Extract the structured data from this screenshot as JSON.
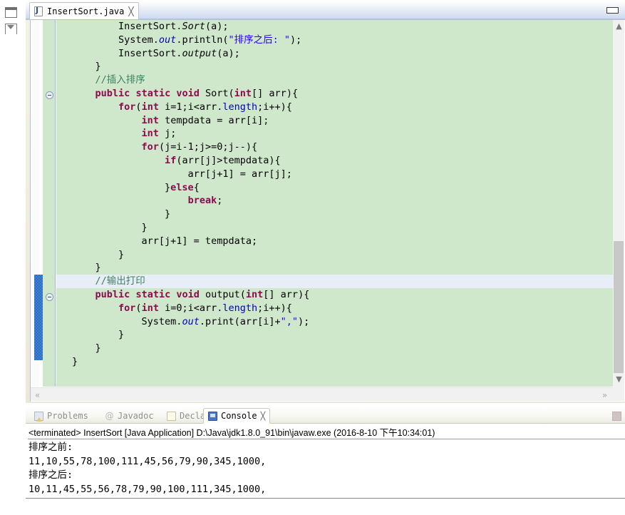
{
  "left_bar": {
    "restore_icon": "restore-window-icon",
    "chevron_icon": "chevron-down-icon"
  },
  "editor": {
    "tab": {
      "icon": "java-file-icon",
      "label": "InsertSort.java",
      "close_glyph": "╳"
    },
    "minimize_glyph": "minimize-icon",
    "fold_markers": [
      "collapse-marker-sort",
      "collapse-marker-output"
    ],
    "scroll": {
      "up_glyph": "▲",
      "down_glyph": "▼",
      "left_glyph": "«",
      "right_glyph": "»"
    },
    "code_lines": [
      {
        "indent": 0,
        "html": "        InsertSort.<i class='smth'>Sort</i>(a);"
      },
      {
        "indent": 0,
        "html": "        System.<i class='sfld'>out</i>.println(<span class='st'>\"排序之后: \"</span>);"
      },
      {
        "indent": 0,
        "html": "        InsertSort.<i class='smth'>output</i>(a);"
      },
      {
        "indent": 0,
        "html": "    }"
      },
      {
        "indent": 0,
        "html": "    <span class='cm'>//插入排序</span>"
      },
      {
        "indent": 0,
        "html": "    <span class='kw'>public</span> <span class='kw'>static</span> <span class='kw'>void</span> Sort(<span class='kw'>int</span>[] arr){"
      },
      {
        "indent": 0,
        "html": "        <span class='kw'>for</span>(<span class='kw'>int</span> i=1;i&lt;arr.<span class='fld'>length</span>;i++){"
      },
      {
        "indent": 0,
        "html": "            <span class='kw'>int</span> tempdata = arr[i];"
      },
      {
        "indent": 0,
        "html": "            <span class='kw'>int</span> j;"
      },
      {
        "indent": 0,
        "html": "            <span class='kw'>for</span>(j=i-1;j&gt;=0;j--){"
      },
      {
        "indent": 0,
        "html": "                <span class='kw'>if</span>(arr[j]&gt;tempdata){"
      },
      {
        "indent": 0,
        "html": "                    arr[j+1] = arr[j];"
      },
      {
        "indent": 0,
        "html": "                }<span class='kw'>else</span>{"
      },
      {
        "indent": 0,
        "html": "                    <span class='kw'>break</span>;"
      },
      {
        "indent": 0,
        "html": "                }"
      },
      {
        "indent": 0,
        "html": "            }"
      },
      {
        "indent": 0,
        "html": "            arr[j+1] = tempdata;"
      },
      {
        "indent": 0,
        "html": "        }"
      },
      {
        "indent": 0,
        "html": "    }"
      },
      {
        "indent": 0,
        "highlight": true,
        "html": "    <span class='cm'>//输出打印</span>"
      },
      {
        "indent": 0,
        "html": "    <span class='kw'>public</span> <span class='kw'>static</span> <span class='kw'>void</span> output(<span class='kw'>int</span>[] arr){"
      },
      {
        "indent": 0,
        "html": "        <span class='kw'>for</span>(<span class='kw'>int</span> i=0;i&lt;arr.<span class='fld'>length</span>;i++){"
      },
      {
        "indent": 0,
        "html": "            System.<i class='sfld'>out</i>.print(arr[i]+<span class='st'>\",\"</span>);"
      },
      {
        "indent": 0,
        "html": "        }"
      },
      {
        "indent": 0,
        "html": "    }"
      },
      {
        "indent": 0,
        "html": "}"
      }
    ]
  },
  "bottom_view": {
    "tabs": [
      {
        "label": "Problems",
        "icon": "problems-icon",
        "active": false
      },
      {
        "label": "Javadoc",
        "icon": "javadoc-icon",
        "active": false
      },
      {
        "label": "Declaration",
        "icon": "declaration-icon",
        "active": false
      },
      {
        "label": "Console",
        "icon": "console-icon",
        "active": true
      }
    ],
    "close_glyph": "╳",
    "terminated_line": "<terminated> InsertSort [Java Application] D:\\Java\\jdk1.8.0_91\\bin\\javaw.exe (2016-8-10 下午10:34:01)",
    "console_output": "排序之前:\n11,10,55,78,100,111,45,56,79,90,345,1000,\n排序之后:\n10,11,45,55,56,78,79,90,100,111,345,1000,"
  },
  "colors": {
    "code_background": "#cfe8cc",
    "highlight_line": "#e8eef8",
    "keyword": "#8b0a4e",
    "comment": "#3f7f5f",
    "string": "#2a00ff",
    "field": "#0000c0",
    "annotation_marker": "#3f7fd0"
  }
}
